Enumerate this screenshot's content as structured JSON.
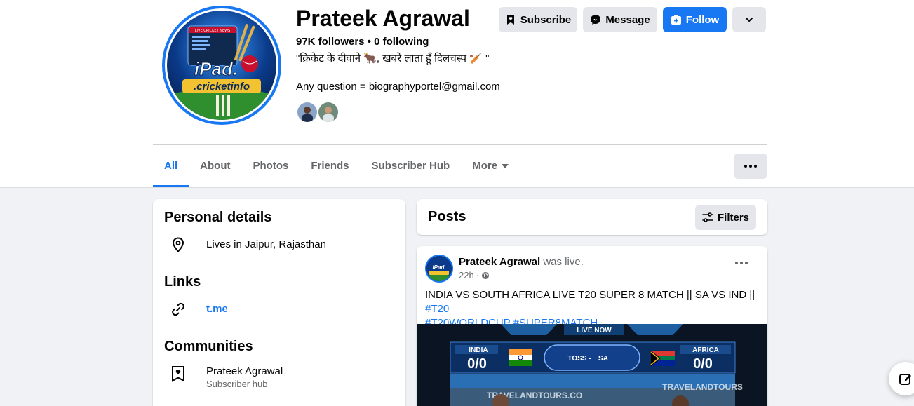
{
  "profile": {
    "name": "Prateek Agrawal",
    "followers_line": "97K followers • 0 following",
    "bio": "\"क्रिकेट के दीवाने 🐂, खबरें लाता हूँ दिलचस्प 🏏 \"",
    "contact": "Any question = biographyportel@gmail.com",
    "avatar_logo_line1": "iPad.",
    "avatar_logo_line2": ".cricketinfo",
    "avatar_banner": "LIVE CRICKET NEWS"
  },
  "actions": {
    "subscribe": "Subscribe",
    "message": "Message",
    "follow": "Follow"
  },
  "tabs": [
    {
      "label": "All"
    },
    {
      "label": "About"
    },
    {
      "label": "Photos"
    },
    {
      "label": "Friends"
    },
    {
      "label": "Subscriber Hub"
    },
    {
      "label": "More"
    }
  ],
  "intro": {
    "personal_title": "Personal details",
    "location": "Lives in Jaipur, Rajasthan",
    "links_title": "Links",
    "link": "t.me",
    "communities_title": "Communities",
    "community_name": "Prateek Agrawal",
    "community_sub": "Subscriber hub"
  },
  "posts_header": {
    "title": "Posts",
    "filters": "Filters"
  },
  "post": {
    "author": "Prateek Agrawal",
    "action": "was live.",
    "time": "22h",
    "text": "INDIA VS SOUTH AFRICA LIVE T20 SUPER 8 MATCH || SA VS IND || ",
    "hashtag1": "#T20",
    "hashtag2": "#T20WORLDCUP",
    "hashtag3": "#SUPER8MATCH",
    "video": {
      "live_now": "LIVE NOW",
      "team1": "INDIA",
      "score1": "0/0",
      "toss": "TOSS -",
      "toss_team": "SA",
      "team2": "AFRICA",
      "score2": "0/0",
      "banner_left": "TRAVELANDTOURS.CO",
      "banner_right": "TRAVELANDTOURS"
    }
  },
  "colors": {
    "accent": "#1877f2",
    "page_bg": "#f0f2f5"
  }
}
